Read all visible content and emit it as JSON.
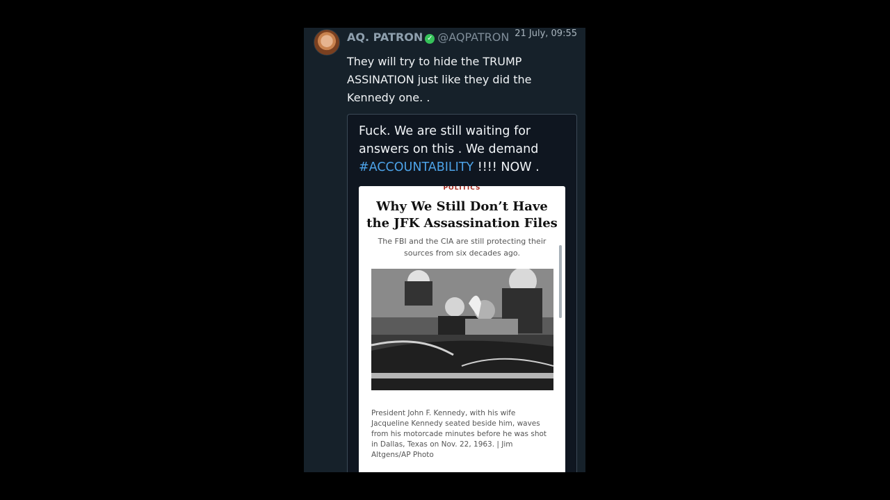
{
  "post": {
    "author_name": "AQ. PATRON",
    "handle": "@AQPATRON",
    "timestamp": "21 July, 09:55",
    "text": "They will try to hide the TRUMP ASSINATION just like they did the Kennedy one. ."
  },
  "quote": {
    "text_before": "Fuck. We are still waiting for answers on this . We demand ",
    "hashtag": "#ACCOUNTABILITY",
    "text_after": " !!!! NOW ."
  },
  "article": {
    "category": "POLITICS",
    "headline": "Why We Still Don’t Have the JFK Assassination Files",
    "dek": "The FBI and the CIA are still protecting their sources from six decades ago.",
    "caption": "President John F. Kennedy, with his wife Jacqueline Kennedy seated beside him, waves from his motorcade minutes before he was shot in Dallas, Texas on Nov. 22, 1963. | Jim Altgens/AP Photo"
  },
  "icons": {
    "verified": "verified-badge-icon",
    "avatar": "profile-avatar"
  },
  "colors": {
    "panel_bg": "#16212a",
    "hashtag": "#4da3e8",
    "verified": "#36c25a",
    "category": "#a7291f"
  }
}
